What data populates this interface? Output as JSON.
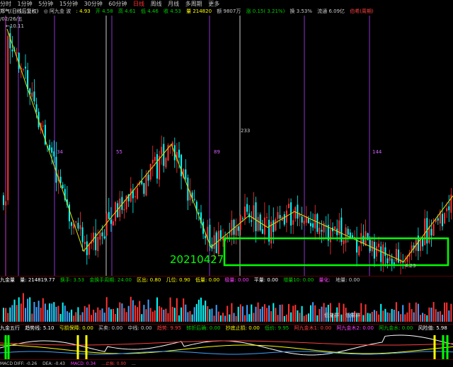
{
  "period_tabs": [
    "分时",
    "1分钟",
    "5分钟",
    "15分钟",
    "30分钟",
    "60分钟",
    "日线",
    "周线",
    "月线",
    "多周期",
    "更多"
  ],
  "active_tab": "日线",
  "info": {
    "stock": "郑气(日线后复权)",
    "indicator": "◎ 阿九金 波",
    "last_value": ": 4.93",
    "open": "开 4.58",
    "high": "高 4.61",
    "low": "低 4.46",
    "close": "收 4.53",
    "volume": "量 214820",
    "amount": "额 9807万",
    "change": "涨 0.15( 3.21%)",
    "turnover": "换 3.53%",
    "circ": "流通 6.09亿",
    "extra": "伯希(周期)"
  },
  "date_label": "/02/26/五",
  "annotations": {
    "high_price": "←10.11",
    "mid_label": "233",
    "date_big": "20210427",
    "low_price": "4.23"
  },
  "cycle_labels": [
    "34",
    "55",
    "89",
    "144"
  ],
  "volume_header": {
    "title": "九金量",
    "vol": "量: 214819.77",
    "turn": "换手: 3.53",
    "amount": "金换手周期: 24.00",
    "zone": "区出: 0.80",
    "ratio": "几位: 0.90",
    "low": "低量: 0.00",
    "fall": "极量: 0.00",
    "flat": "平量: 0.00",
    "avg": "增量10: 0.00",
    "vol2": "量化:",
    "x1": "地量: 0.00"
  },
  "volume_labels": {
    "left": "低量群",
    "right": "低量群"
  },
  "indicator_header": {
    "title": "九金五行",
    "t1": "趋势线: 5.10",
    "t2": "亏损保障: 0.00",
    "t3": "买卖: 0.00",
    "t4": "中线: 0.00",
    "t5": "趋势: 9.95",
    "t6": "转折后确: 0.00",
    "t7": "抄底止损: 0.00",
    "t8": "低价: 9.95",
    "t9": "阿九金木1: 0.00",
    "t10": "阿九金木2: 0.00",
    "t11": "阿九金水: 0.00",
    "t12": "风险值: 5.98"
  },
  "bottom_bar": [
    "MACD DIFF: -0.26",
    "DEA: -0.43",
    "MACD: 0.34",
    "...止损: 0.00",
    "..."
  ],
  "colors": {
    "up": "#ff3333",
    "down": "#00ffff",
    "zigzag": "#e0e000",
    "highlight": "#00ff00",
    "cycle": "#b040ff"
  },
  "chart_data": {
    "type": "candlestick",
    "price_range": [
      4.2,
      10.2
    ],
    "pivots": [
      10.11,
      4.5,
      7.2,
      4.6,
      5.4,
      5.1,
      5.5,
      4.23,
      5.9
    ],
    "cycle_marks": [
      34,
      55,
      89,
      144
    ]
  }
}
